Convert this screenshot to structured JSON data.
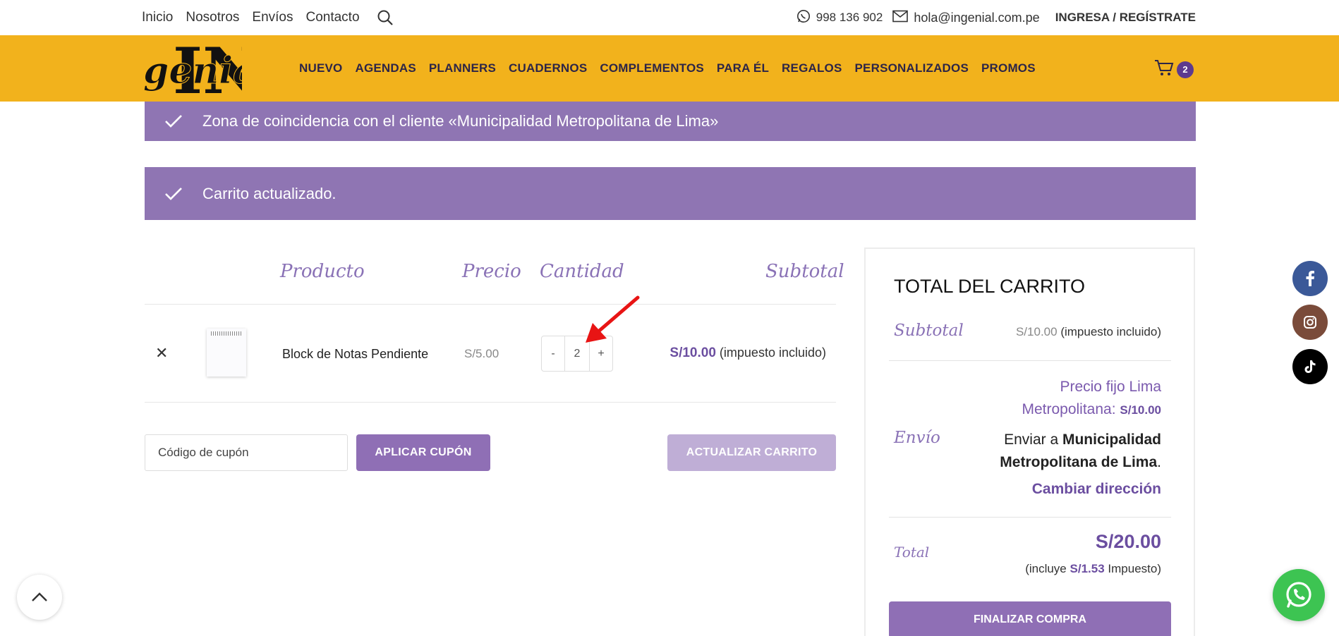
{
  "topbar": {
    "links": [
      "Inicio",
      "Nosotros",
      "Envíos",
      "Contacto"
    ],
    "phone": "998 136 902",
    "email": "hola@ingenial.com.pe",
    "login": "INGRESA / REGÍSTRATE"
  },
  "header": {
    "logo_text": "genial",
    "logo_monogram": "IN",
    "nav": [
      "NUEVO",
      "AGENDAS",
      "PLANNERS",
      "CUADERNOS",
      "COMPLEMENTOS",
      "PARA ÉL",
      "REGALOS",
      "PERSONALIZADOS",
      "PROMOS"
    ],
    "cart_count": "2",
    "accent": "#f2b21c"
  },
  "notices": {
    "zone": "Zona de coincidencia con el cliente «Municipalidad Metropolitana de Lima»",
    "updated": "Carrito actualizado."
  },
  "cart": {
    "headers": {
      "product": "Producto",
      "price": "Precio",
      "quantity": "Cantidad",
      "subtotal": "Subtotal"
    },
    "item": {
      "remove": "✕",
      "name": "Block de Notas Pendiente",
      "price": "S/5.00",
      "qty_minus": "-",
      "qty": "2",
      "qty_plus": "+",
      "subtotal": "S/10.00",
      "tax_note": "(impuesto incluido)"
    },
    "coupon_placeholder": "Código de cupón",
    "apply_label": "APLICAR CUPÓN",
    "update_label": "ACTUALIZAR CARRITO"
  },
  "totals": {
    "title": "TOTAL DEL CARRITO",
    "subtotal_label": "Subtotal",
    "subtotal_value": "S/10.00",
    "subtotal_note": "(impuesto incluido)",
    "shipping_label": "Envío",
    "shipping_method": "Precio fijo Lima Metropolitana:",
    "shipping_price": "S/10.00",
    "ship_to_prefix": "Enviar a",
    "ship_to": "Municipalidad Metropolitana de Lima",
    "change_address": "Cambiar dirección",
    "total_label": "Total",
    "total_value": "S/20.00",
    "tax_prefix": "(incluye",
    "tax_value": "S/1.53",
    "tax_suffix": "Impuesto)",
    "checkout_label": "FINALIZAR COMPRA"
  },
  "colors": {
    "purple": "#8f75b3",
    "purple_dark": "#6b4ea0",
    "whatsapp": "#3dc452",
    "facebook": "#3b5998",
    "instagram": "#7a4b3a",
    "tiktok": "#000000"
  }
}
